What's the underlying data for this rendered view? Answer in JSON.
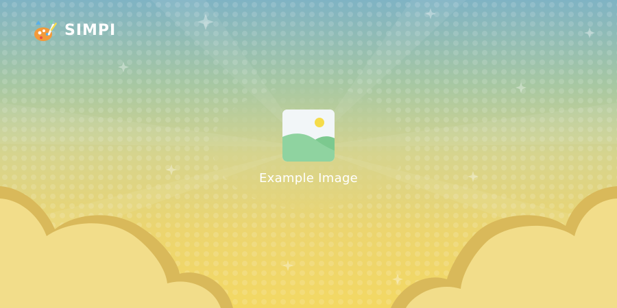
{
  "brand": {
    "name": "SIMPI",
    "logo_icon": "painter-palette-icon"
  },
  "placeholder": {
    "icon": "image-placeholder-icon",
    "caption": "Example Image"
  },
  "colors": {
    "sky_top": "#7fb3c4",
    "sky_bottom": "#f3d863",
    "cloud_fill": "#f2dd8a",
    "cloud_outline": "#d9b95a",
    "placeholder_hill": "#8fd3a0",
    "placeholder_sun": "#f5dc4a",
    "text": "#ffffff"
  }
}
